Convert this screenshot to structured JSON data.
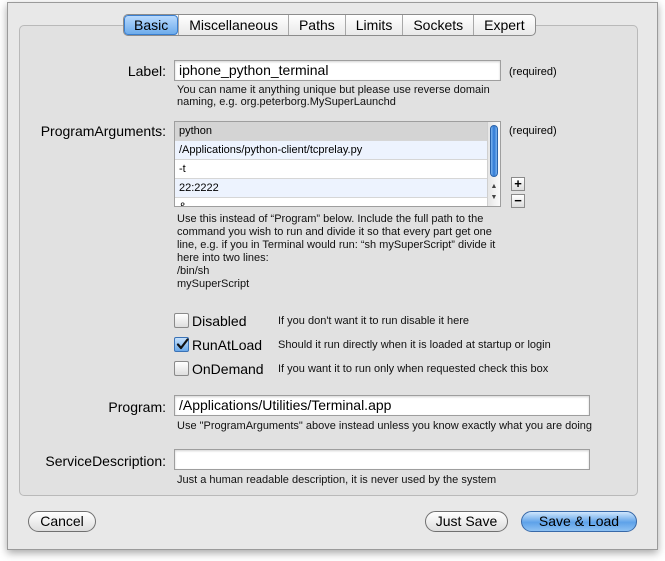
{
  "tabs": [
    {
      "label": "Basic",
      "active": true
    },
    {
      "label": "Miscellaneous",
      "active": false
    },
    {
      "label": "Paths",
      "active": false
    },
    {
      "label": "Limits",
      "active": false
    },
    {
      "label": "Sockets",
      "active": false
    },
    {
      "label": "Expert",
      "active": false
    }
  ],
  "label_field": {
    "label": "Label:",
    "value": "iphone_python_terminal",
    "required": "(required)",
    "help_line1": "You can name it anything unique but please use reverse domain",
    "help_line2": "naming, e.g. org.peterborg.MySuperLaunchd"
  },
  "program_arguments": {
    "label": "ProgramArguments:",
    "required": "(required)",
    "items": [
      "python",
      "/Applications/python-client/tcprelay.py",
      "-t",
      "22:2222",
      "&"
    ],
    "add_label": "+",
    "remove_label": "−",
    "help_lines": [
      "Use this instead of “Program” below. Include the full path to the",
      "command you wish to run and divide it so that every part get one",
      "line, e.g. if you in Terminal would run: “sh mySuperScript” divide it",
      "here into two lines:",
      "/bin/sh",
      "mySuperScript"
    ]
  },
  "checkboxes": [
    {
      "label": "Disabled",
      "checked": false,
      "help": "If you don't want it to run disable it here"
    },
    {
      "label": "RunAtLoad",
      "checked": true,
      "help": "Should it run directly when it is loaded at startup or login"
    },
    {
      "label": "OnDemand",
      "checked": false,
      "help": "If you want it to run only when requested check this box"
    }
  ],
  "program": {
    "label": "Program:",
    "value": "/Applications/Utilities/Terminal.app",
    "help": "Use \"ProgramArguments\" above instead unless you know exactly what you are doing"
  },
  "service_description": {
    "label": "ServiceDescription:",
    "value": "",
    "help": "Just a human readable description, it is never used by the system"
  },
  "buttons": {
    "cancel": "Cancel",
    "just_save": "Just Save",
    "save_load": "Save & Load"
  }
}
